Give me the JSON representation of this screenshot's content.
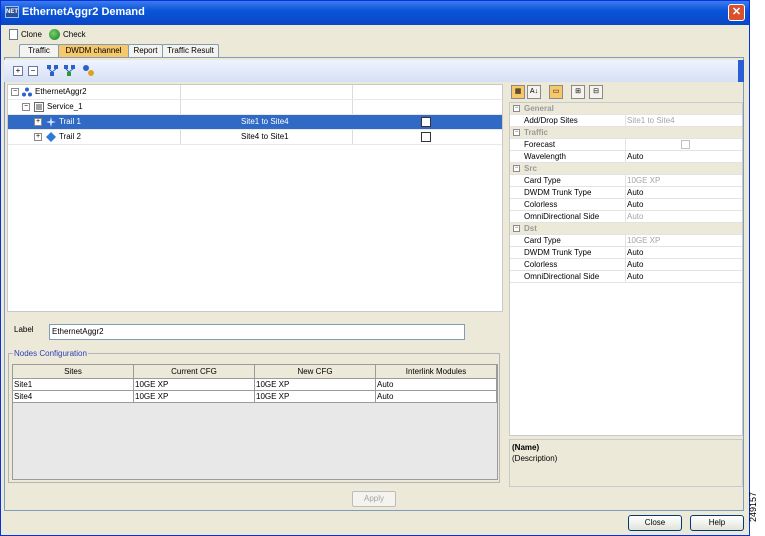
{
  "window": {
    "title": "EthernetAggr2 Demand",
    "icon_text": "NET"
  },
  "toolbar": {
    "clone_label": "Clone",
    "check_label": "Check"
  },
  "tabs": [
    {
      "label": "Traffic"
    },
    {
      "label": "DWDM channel"
    },
    {
      "label": "Report"
    },
    {
      "label": "Traffic Result"
    }
  ],
  "active_tab": "DWDM channel",
  "tree": {
    "rows": [
      {
        "label": "EthernetAggr2",
        "sites": "",
        "checked": null
      },
      {
        "label": "Service_1",
        "sites": "",
        "checked": null
      },
      {
        "label": "Trail 1",
        "sites": "Site1 to Site4",
        "checked": false,
        "selected": true
      },
      {
        "label": "Trail 2",
        "sites": "Site4 to Site1",
        "checked": false
      }
    ]
  },
  "label_field": {
    "label": "Label",
    "value": "EthernetAggr2"
  },
  "nodes_config": {
    "title": "Nodes Configuration",
    "columns": [
      "Sites",
      "Current CFG",
      "New CFG",
      "Interlink Modules"
    ],
    "rows": [
      [
        "Site1",
        "10GE XP",
        "10GE XP",
        "Auto"
      ],
      [
        "Site4",
        "10GE XP",
        "10GE XP",
        "Auto"
      ]
    ]
  },
  "apply_label": "Apply",
  "properties": {
    "groups": [
      {
        "name": "General",
        "items": [
          {
            "name": "Add/Drop Sites",
            "value": "Site1 to Site4",
            "dim": true
          }
        ]
      },
      {
        "name": "Traffic",
        "items": [
          {
            "name": "Forecast",
            "value": "",
            "checkbox": true
          },
          {
            "name": "Wavelength",
            "value": "Auto"
          }
        ]
      },
      {
        "name": "Src",
        "items": [
          {
            "name": "Card Type",
            "value": "10GE XP",
            "dim": true
          },
          {
            "name": "DWDM Trunk Type",
            "value": "Auto"
          },
          {
            "name": "Colorless",
            "value": "Auto"
          },
          {
            "name": "OmniDirectional Side",
            "value": "Auto",
            "dim": true
          }
        ]
      },
      {
        "name": "Dst",
        "items": [
          {
            "name": "Card Type",
            "value": "10GE XP",
            "dim": true
          },
          {
            "name": "DWDM Trunk Type",
            "value": "Auto"
          },
          {
            "name": "Colorless",
            "value": "Auto"
          },
          {
            "name": "OmniDirectional Side",
            "value": "Auto"
          }
        ]
      }
    ]
  },
  "description": {
    "name": "(Name)",
    "text": "(Description)"
  },
  "buttons": {
    "close": "Close",
    "help": "Help"
  },
  "figure_number": "249157"
}
